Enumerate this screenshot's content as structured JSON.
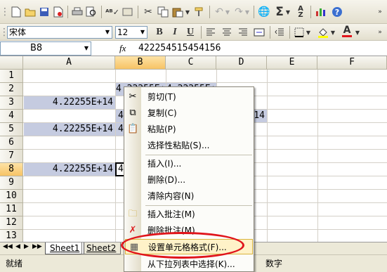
{
  "toolbar": {
    "icons": [
      "new-icon",
      "open-icon",
      "save-icon",
      "permission-icon",
      "print-icon",
      "print-preview-icon",
      "spelling-icon",
      "research-icon",
      "cut-icon",
      "copy-icon",
      "paste-icon",
      "format-painter-icon",
      "undo-icon",
      "redo-icon",
      "hyperlink-icon",
      "autosum-icon",
      "sort-ascending-icon",
      "chart-wizard-icon",
      "help-icon"
    ],
    "autosum_glyph": "Σ"
  },
  "format_toolbar": {
    "font": "宋体",
    "size": "12",
    "bold": "B",
    "italic": "I",
    "underline": "U",
    "font_color_glyph": "A"
  },
  "formula_bar": {
    "name_box": "B8",
    "fx": "fx",
    "value": "422254515454156"
  },
  "columns": [
    "A",
    "B",
    "C",
    "D",
    "E",
    "F"
  ],
  "rows": [
    "1",
    "2",
    "3",
    "4",
    "5",
    "6",
    "7",
    "8",
    "9",
    "10",
    "11",
    "12",
    "13"
  ],
  "cells": {
    "A3": "4.22255E+14",
    "A5": "4.22255E+14",
    "A8": "4.22255E+14",
    "B2": "4.22255E+14",
    "C2": "4.22255E+14",
    "B4": "4.",
    "D4": "14",
    "B5": "4.",
    "B8": "4."
  },
  "context_menu": {
    "items": [
      {
        "label": "剪切(T)",
        "icon": "scissors-icon",
        "glyph": "✂"
      },
      {
        "label": "复制(C)",
        "icon": "copy-icon",
        "glyph": "⧉"
      },
      {
        "label": "粘贴(P)",
        "icon": "paste-icon",
        "glyph": "📋"
      },
      {
        "label": "选择性粘贴(S)...",
        "icon": "",
        "glyph": ""
      },
      {
        "label": "插入(I)...",
        "icon": "",
        "glyph": ""
      },
      {
        "label": "删除(D)...",
        "icon": "",
        "glyph": ""
      },
      {
        "label": "清除内容(N)",
        "icon": "",
        "glyph": ""
      },
      {
        "label": "插入批注(M)",
        "icon": "insert-comment-icon",
        "glyph": "🗀"
      },
      {
        "label": "删除批注(M)",
        "icon": "delete-comment-icon",
        "glyph": "✗"
      },
      {
        "label": "设置单元格格式(F)...",
        "icon": "format-cells-icon",
        "glyph": "▦"
      },
      {
        "label": "从下拉列表中选择(K)...",
        "icon": "",
        "glyph": ""
      }
    ]
  },
  "sheet_tabs": {
    "nav": [
      "◀◀",
      "◀",
      "▶",
      "▶▶"
    ],
    "tabs": [
      "Sheet1",
      "Sheet2"
    ]
  },
  "status_bar": {
    "left": "就绪",
    "right": "数字"
  },
  "colors": {
    "highlight_oval": "#e0141b",
    "selected_cells": "#c5cbe0",
    "active_header": "#f7c365"
  }
}
